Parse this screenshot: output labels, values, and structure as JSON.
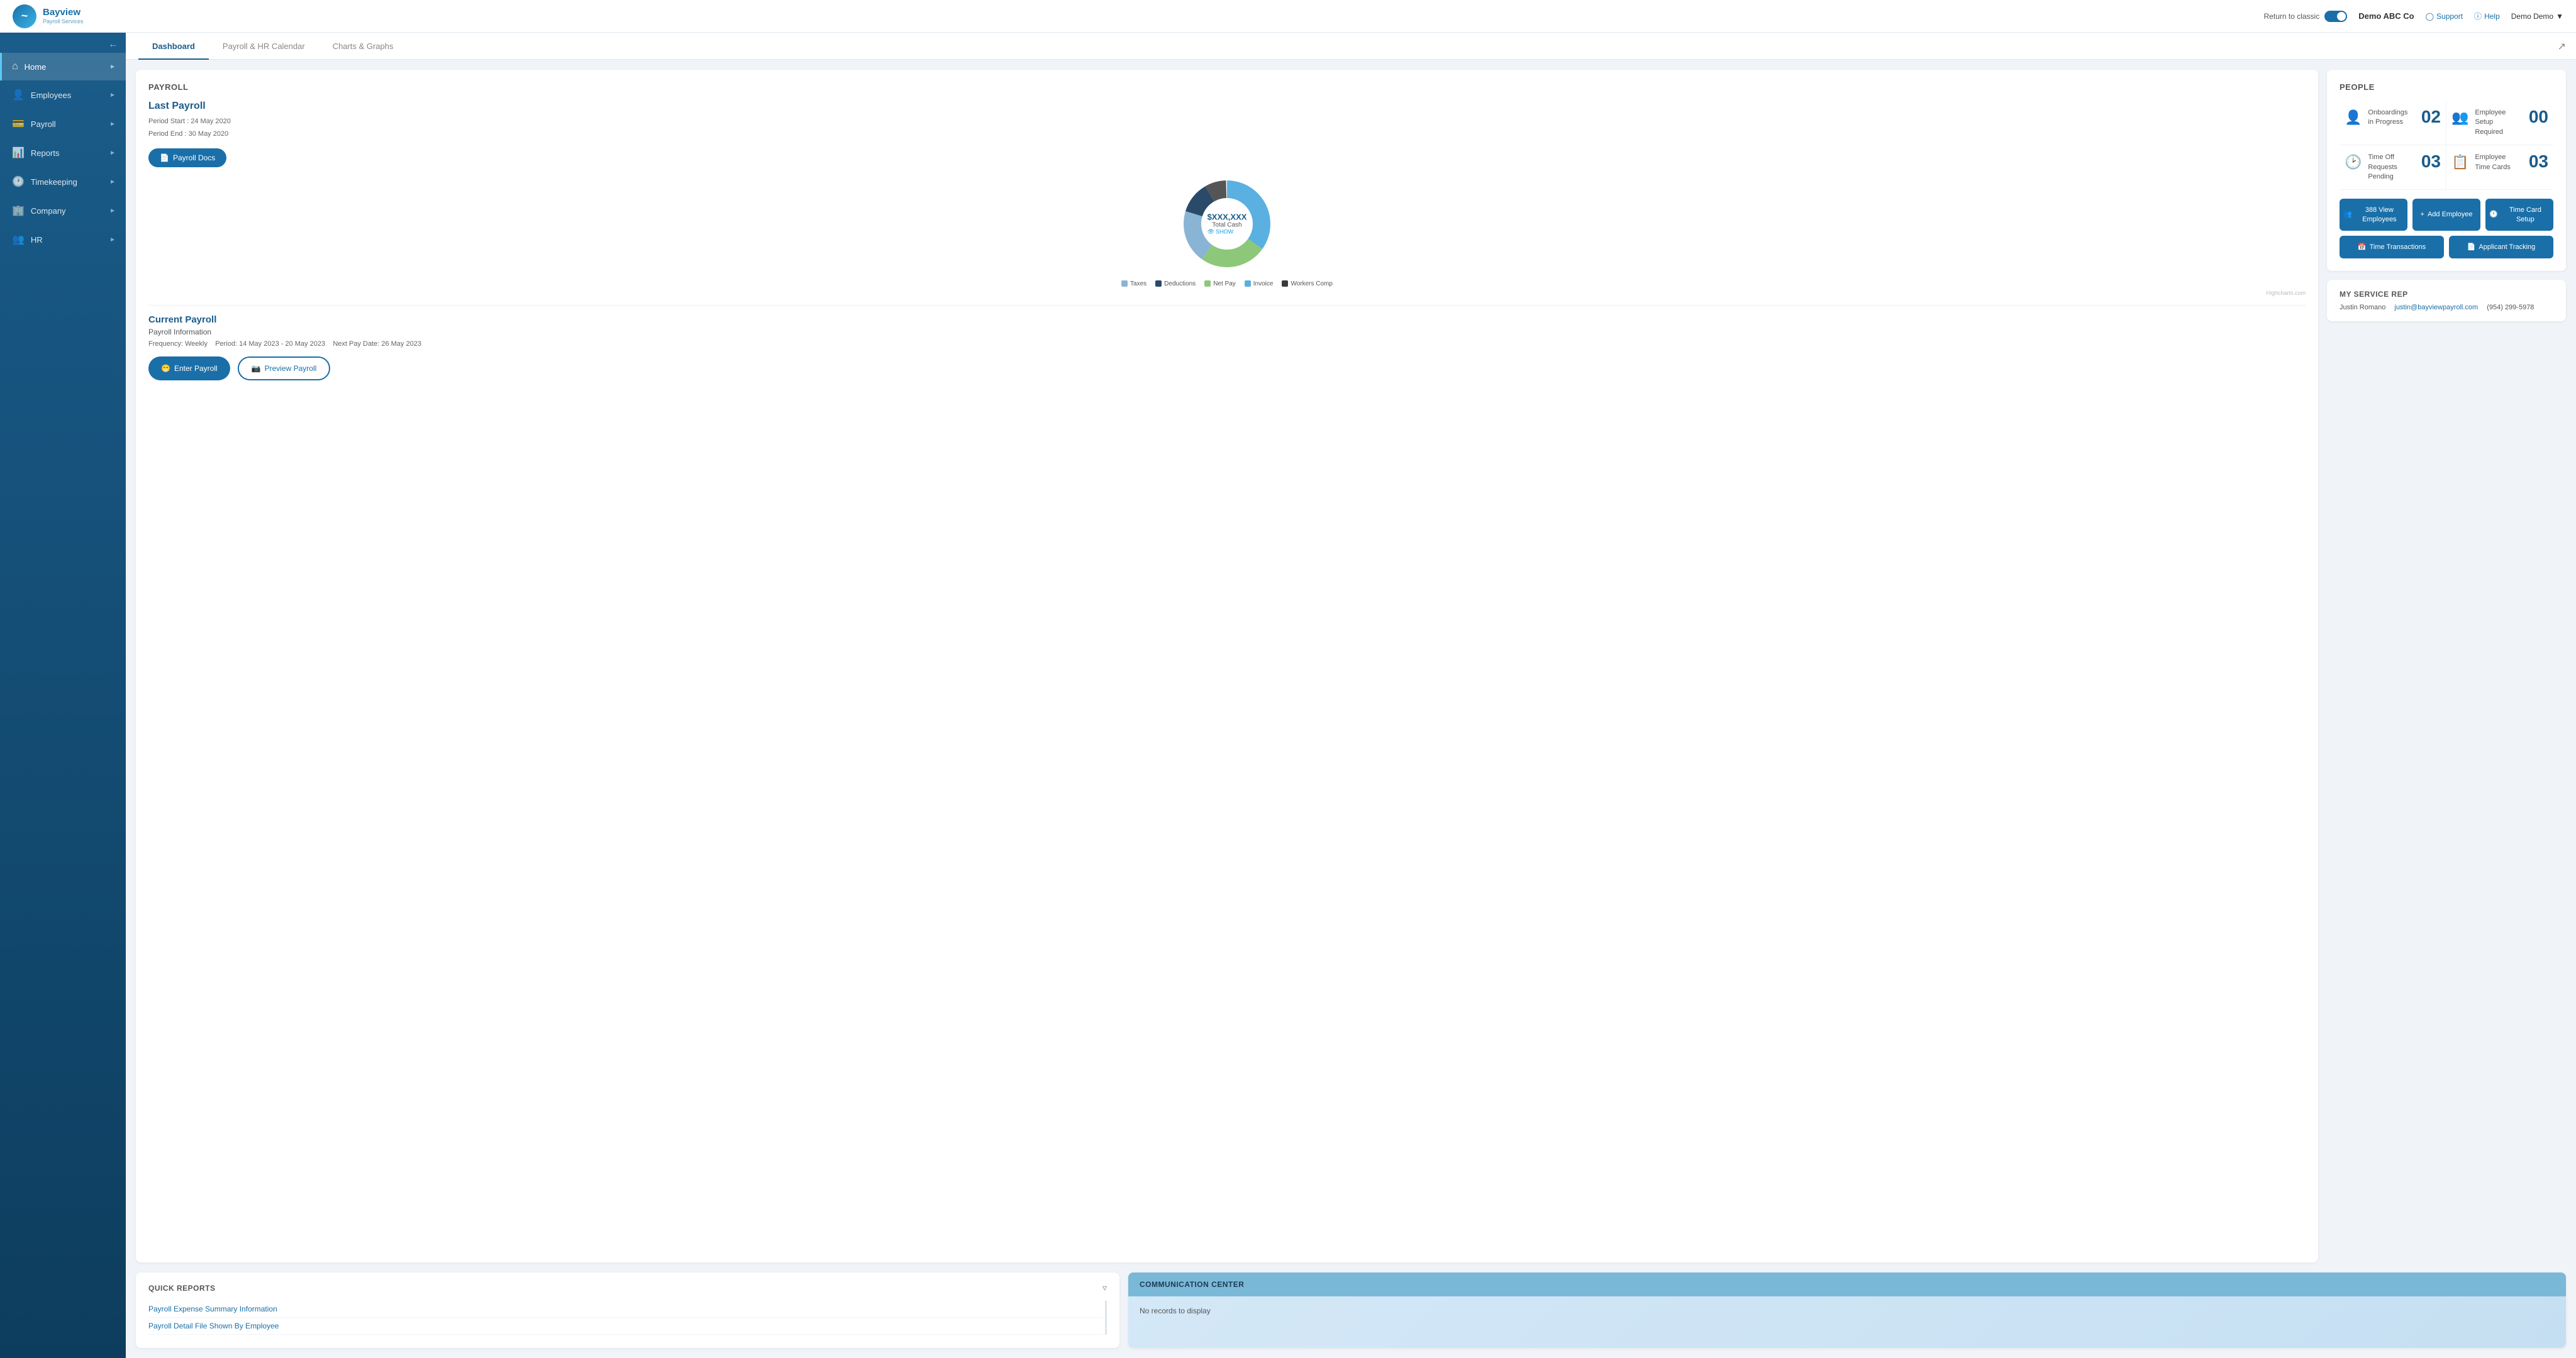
{
  "header": {
    "logo_text": "Bayview",
    "logo_sub": "Payroll Services",
    "return_to_classic": "Return to classic",
    "company_name": "Demo ABC Co",
    "support_label": "Support",
    "help_label": "Help",
    "user_label": "Demo Demo"
  },
  "sidebar": {
    "items": [
      {
        "id": "home",
        "label": "Home",
        "active": true
      },
      {
        "id": "employees",
        "label": "Employees",
        "active": false
      },
      {
        "id": "payroll",
        "label": "Payroll",
        "active": false
      },
      {
        "id": "reports",
        "label": "Reports",
        "active": false
      },
      {
        "id": "timekeeping",
        "label": "Timekeeping",
        "active": false
      },
      {
        "id": "company",
        "label": "Company",
        "active": false
      },
      {
        "id": "hr",
        "label": "HR",
        "active": false
      }
    ]
  },
  "tabs": {
    "items": [
      {
        "id": "dashboard",
        "label": "Dashboard",
        "active": true
      },
      {
        "id": "payroll-hr-calendar",
        "label": "Payroll & HR Calendar",
        "active": false
      },
      {
        "id": "charts-graphs",
        "label": "Charts & Graphs",
        "active": false
      }
    ]
  },
  "payroll": {
    "section_title": "PAYROLL",
    "last_payroll_title": "Last Payroll",
    "period_start_label": "Period Start :",
    "period_start_value": "24 May 2020",
    "period_end_label": "Period End :",
    "period_end_value": "30 May 2020",
    "payroll_docs_btn": "Payroll Docs",
    "chart": {
      "center_amount": "$XXX,XXX",
      "center_label": "Total Cash",
      "show_label": "SHOW",
      "legend": [
        {
          "label": "Taxes",
          "color": "#8ab4d4"
        },
        {
          "label": "Deductions",
          "color": "#2a4a6a"
        },
        {
          "label": "Net Pay",
          "color": "#8dc87a"
        },
        {
          "label": "Invoice",
          "color": "#5ab0e0"
        },
        {
          "label": "Workers Comp",
          "color": "#3a3a3a"
        }
      ],
      "highcharts_credit": "Highcharts.com",
      "segments": [
        {
          "value": 35,
          "color": "#5ab0e0",
          "startAngle": -90
        },
        {
          "value": 25,
          "color": "#8dc87a",
          "startAngle": 36
        },
        {
          "value": 20,
          "color": "#8ab4d4",
          "startAngle": 126
        },
        {
          "value": 12,
          "color": "#2a4a6a",
          "startAngle": 198
        },
        {
          "value": 8,
          "color": "#3a3a3a",
          "startAngle": 241
        }
      ]
    },
    "current_payroll_title": "Current Payroll",
    "payroll_information_label": "Payroll Information",
    "frequency": "Frequency: Weekly",
    "period": "Period: 14 May 2023 - 20 May 2023",
    "next_pay_date": "Next Pay Date: 26 May 2023",
    "enter_payroll_btn": "Enter Payroll",
    "preview_payroll_btn": "Preview Payroll"
  },
  "people": {
    "section_title": "PEOPLE",
    "stats": [
      {
        "label": "Onboardings in Progress",
        "value": "02"
      },
      {
        "label": "Employee Setup Required",
        "value": "00"
      },
      {
        "label": "Time Off Requests Pending",
        "value": "03"
      },
      {
        "label": "Employee Time Cards",
        "value": "03"
      }
    ],
    "buttons_row1": [
      {
        "id": "view-employees",
        "label": "388 View Employees"
      },
      {
        "id": "add-employee",
        "label": "Add Employee"
      },
      {
        "id": "time-card-setup",
        "label": "Time Card Setup"
      }
    ],
    "buttons_row2": [
      {
        "id": "time-transactions",
        "label": "Time Transactions"
      },
      {
        "id": "applicant-tracking",
        "label": "Applicant Tracking"
      }
    ]
  },
  "service_rep": {
    "title": "MY SERVICE REP",
    "name": "Justin Romano",
    "email": "justin@bayviewpayroll.com",
    "phone": "(954) 299-5978"
  },
  "quick_reports": {
    "title": "QUICK REPORTS",
    "items": [
      "Payroll Expense Summary Information",
      "Payroll Detail File Shown By Employee"
    ]
  },
  "comm_center": {
    "title": "COMMUNICATION CENTER",
    "empty_message": "No records to display"
  }
}
